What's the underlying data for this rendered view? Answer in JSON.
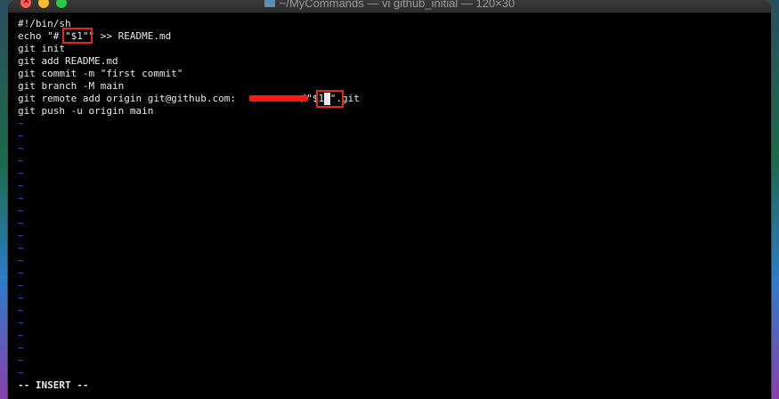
{
  "window": {
    "title": "~/MyCommands — vi github_initial — 120×30"
  },
  "editor": {
    "lines": [
      "#!/bin/sh",
      "echo \"# \"$1\"\" >> README.md",
      "git init",
      "git add README.md",
      "git commit -m \"first commit\"",
      "git branch -M main",
      "git remote add origin git@github.com:",
      "git push -u origin main"
    ],
    "line7_tail_a": "s/\"$1",
    "line7_tail_b": "\".git",
    "tilde": "~",
    "tilde_count": 21
  },
  "status": {
    "mode": "-- INSERT --"
  },
  "colors": {
    "tilde": "#2e5bd6",
    "highlight_box": "#e0281c",
    "redaction": "#ff1a0a"
  }
}
